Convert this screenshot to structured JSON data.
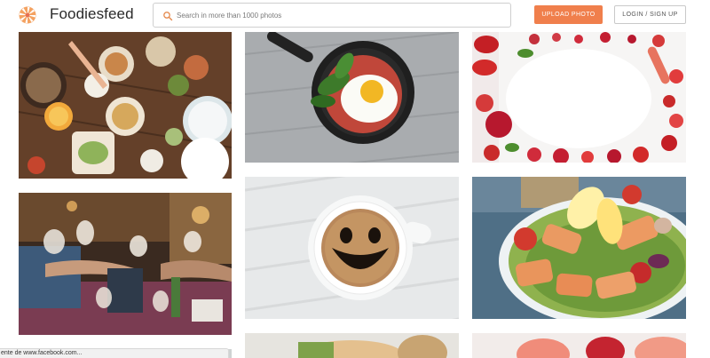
{
  "header": {
    "brand": "Foodiesfeed",
    "search_placeholder": "Search in more than 1000 photos",
    "upload_label": "UPLOAD PHOTO",
    "login_label": "LOGIN / SIGN UP"
  },
  "status_bar": {
    "text": "ente de www.facebook.com..."
  },
  "colors": {
    "accent": "#f07f4c",
    "logo_orange": "#f07f4c"
  }
}
